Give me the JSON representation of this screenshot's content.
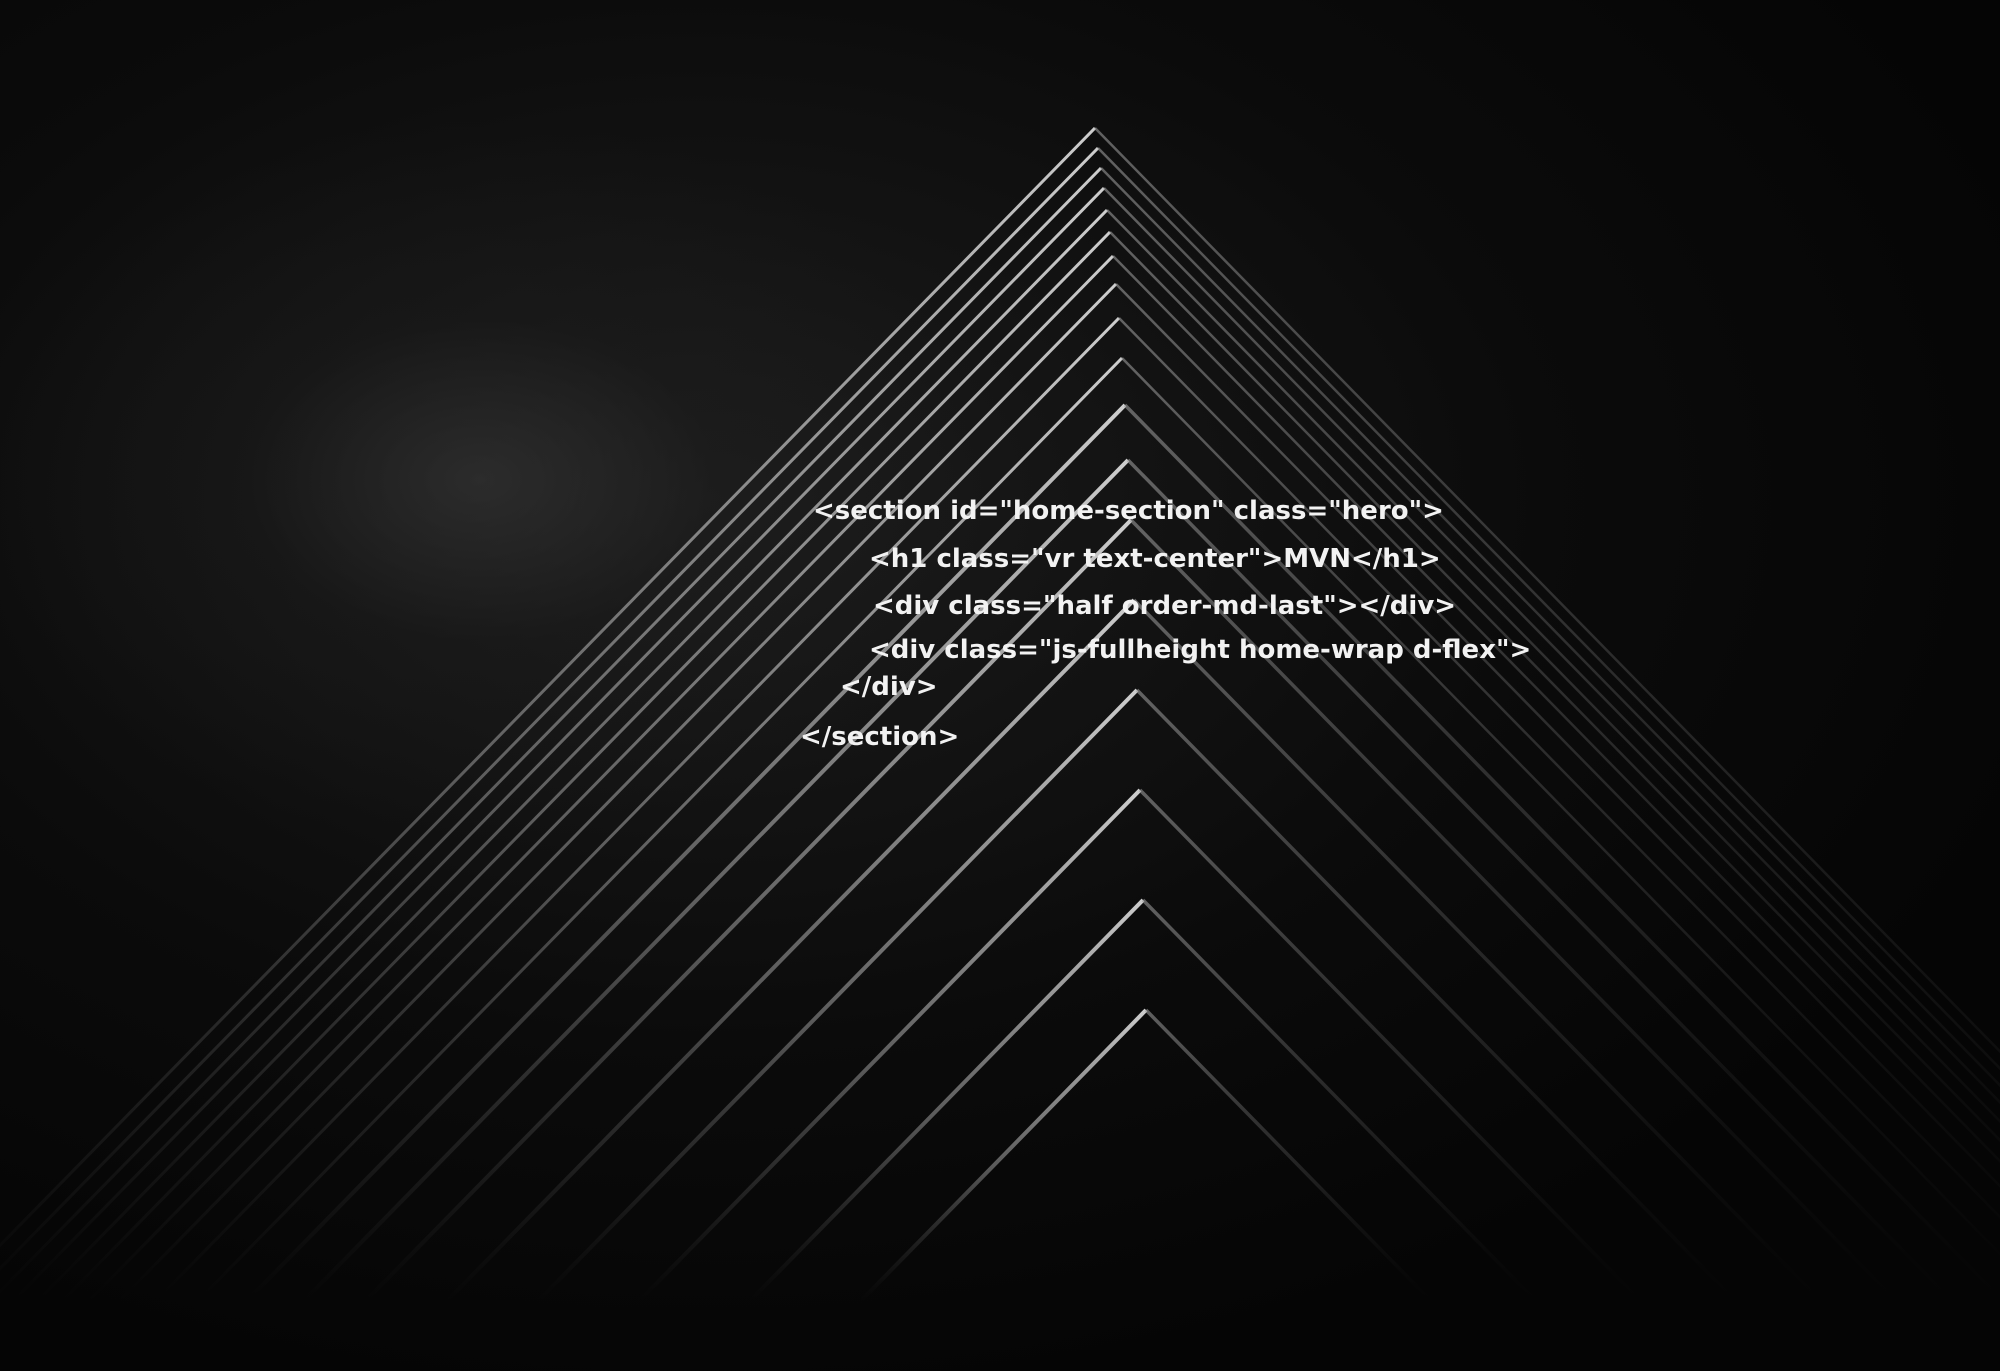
{
  "code_overlay": {
    "lines": [
      "<section id=\"home-section\" class=\"hero\">",
      "<h1 class=\"vr text-center\">MVN</h1>",
      "<div class=\"half order-md-last\"></div>",
      "<div class=\"js-fullheight home-wrap d-flex\">",
      "</div>",
      "</section>"
    ]
  },
  "background": {
    "subject": "pyramid-building-edges",
    "colors": {
      "base": "#050505",
      "glow": "#2a2a2a",
      "edge_light": "#bdbdbd",
      "text": "#f2f2f2"
    }
  }
}
